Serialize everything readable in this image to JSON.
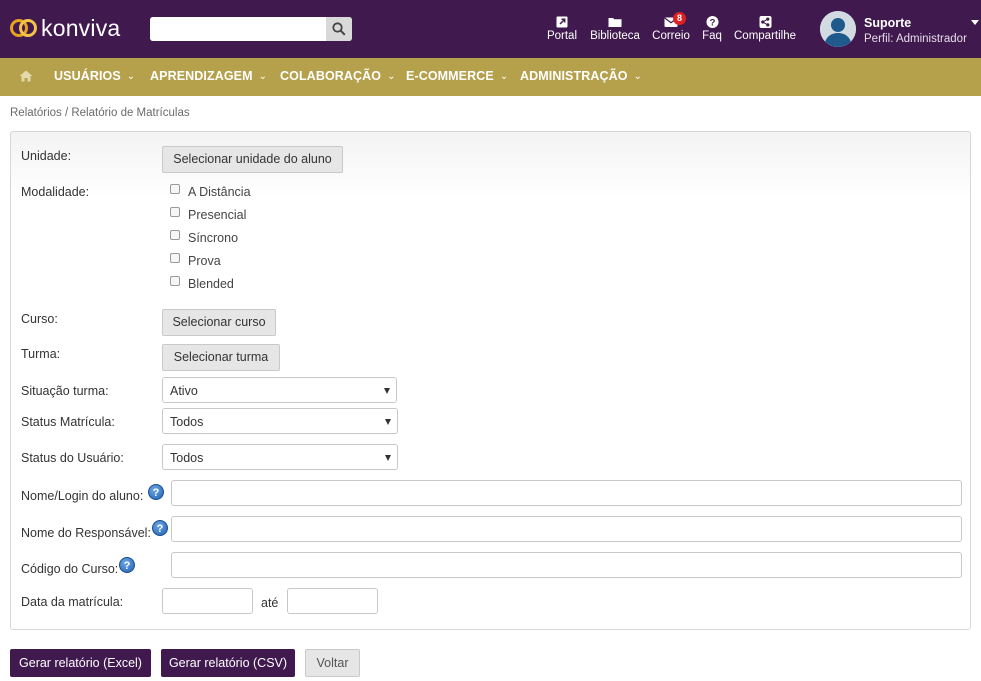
{
  "brand": {
    "name": "konviva"
  },
  "search": {
    "placeholder": "",
    "value": ""
  },
  "topnav": [
    {
      "label": "Portal",
      "icon": "external-link-icon"
    },
    {
      "label": "Biblioteca",
      "icon": "folder-icon"
    },
    {
      "label": "Correio",
      "icon": "envelope-icon",
      "badge": "8"
    },
    {
      "label": "Faq",
      "icon": "question-icon"
    },
    {
      "label": "Compartilhe",
      "icon": "share-icon"
    }
  ],
  "user": {
    "name": "Suporte",
    "role": "Perfil: Administrador"
  },
  "menu": [
    "USUÁRIOS",
    "APRENDIZAGEM",
    "COLABORAÇÃO",
    "E-COMMERCE",
    "ADMINISTRAÇÃO"
  ],
  "breadcrumb": "Relatórios / Relatório de Matrículas",
  "form": {
    "unidade_label": "Unidade:",
    "unidade_button": "Selecionar unidade do aluno",
    "modalidade_label": "Modalidade:",
    "modalidades": [
      "A Distância",
      "Presencial",
      "Síncrono",
      "Prova",
      "Blended"
    ],
    "curso_label": "Curso:",
    "curso_button": "Selecionar curso",
    "turma_label": "Turma:",
    "turma_button": "Selecionar turma",
    "situacao_label": "Situação turma:",
    "situacao_value": "Ativo",
    "status_matricula_label": "Status Matrícula:",
    "status_matricula_value": "Todos",
    "status_usuario_label": "Status do Usuário:",
    "status_usuario_value": "Todos",
    "nome_login_label": "Nome/Login do aluno:",
    "nome_responsavel_label": "Nome do Responsável:",
    "codigo_curso_label": "Código do Curso:",
    "data_matricula_label": "Data da matrícula:",
    "ate_label": "até",
    "help_glyph": "?"
  },
  "actions": {
    "excel": "Gerar relatório (Excel)",
    "csv": "Gerar relatório (CSV)",
    "voltar": "Voltar"
  },
  "colors": {
    "topbar": "#40194f",
    "menubar": "#b5a04c",
    "primary": "#40194f"
  }
}
